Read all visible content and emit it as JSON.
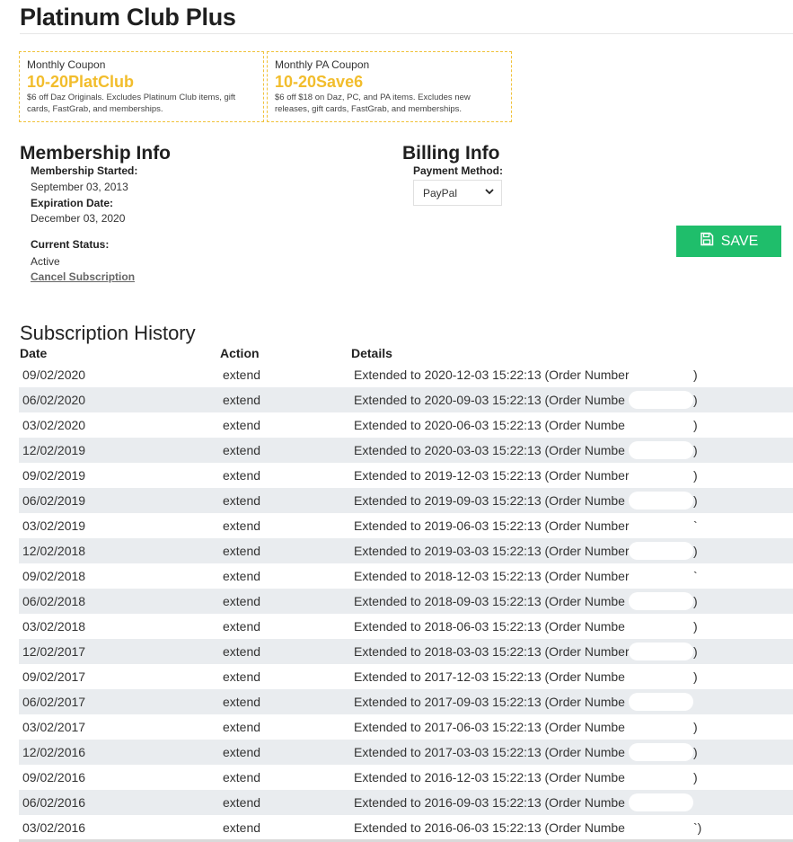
{
  "page": {
    "title": "Platinum Club Plus"
  },
  "coupons": [
    {
      "label": "Monthly Coupon",
      "code": "10-20PlatClub",
      "description": "$6 off Daz Originals. Excludes Platinum Club items, gift cards, FastGrab, and memberships."
    },
    {
      "label": "Monthly PA Coupon",
      "code": "10-20Save6",
      "description": "$6 off $18 on Daz, PC, and PA items. Excludes new releases, gift cards, FastGrab, and memberships."
    }
  ],
  "membership": {
    "heading": "Membership Info",
    "started_label": "Membership Started:",
    "started_value": "September 03, 2013",
    "expiration_label": "Expiration Date:",
    "expiration_value": "December 03, 2020",
    "status_label": "Current Status:",
    "status_value": "Active",
    "cancel_label": "Cancel Subscription"
  },
  "billing": {
    "heading": "Billing Info",
    "payment_label": "Payment Method:",
    "payment_value": "PayPal",
    "save_label": "SAVE"
  },
  "colors": {
    "save_button": "#1fbe6b",
    "coupon_code": "#f2bd2c",
    "row_alt": "#e9ecef"
  },
  "history": {
    "heading": "Subscription History",
    "columns": [
      "Date",
      "Action",
      "Details"
    ],
    "rows": [
      {
        "date": "09/02/2020",
        "action": "extend",
        "details": "Extended to 2020-12-03 15:22:13 (Order Number",
        "close": ")"
      },
      {
        "date": "06/02/2020",
        "action": "extend",
        "details": "Extended to 2020-09-03 15:22:13 (Order Numbe",
        "close": ")"
      },
      {
        "date": "03/02/2020",
        "action": "extend",
        "details": "Extended to 2020-06-03 15:22:13 (Order Numbe",
        "close": ")"
      },
      {
        "date": "12/02/2019",
        "action": "extend",
        "details": "Extended to 2020-03-03 15:22:13 (Order Numbe",
        "close": ")"
      },
      {
        "date": "09/02/2019",
        "action": "extend",
        "details": "Extended to 2019-12-03 15:22:13 (Order Number",
        "close": ")"
      },
      {
        "date": "06/02/2019",
        "action": "extend",
        "details": "Extended to 2019-09-03 15:22:13 (Order Numbe",
        "close": ")"
      },
      {
        "date": "03/02/2019",
        "action": "extend",
        "details": "Extended to 2019-06-03 15:22:13 (Order Number",
        "close": "`"
      },
      {
        "date": "12/02/2018",
        "action": "extend",
        "details": "Extended to 2019-03-03 15:22:13 (Order Number",
        "close": ")"
      },
      {
        "date": "09/02/2018",
        "action": "extend",
        "details": "Extended to 2018-12-03 15:22:13 (Order Number",
        "close": "`"
      },
      {
        "date": "06/02/2018",
        "action": "extend",
        "details": "Extended to 2018-09-03 15:22:13 (Order Numbe",
        "close": ")"
      },
      {
        "date": "03/02/2018",
        "action": "extend",
        "details": "Extended to 2018-06-03 15:22:13 (Order Numbe",
        "close": ")"
      },
      {
        "date": "12/02/2017",
        "action": "extend",
        "details": "Extended to 2018-03-03 15:22:13 (Order Number",
        "close": ")"
      },
      {
        "date": "09/02/2017",
        "action": "extend",
        "details": "Extended to 2017-12-03 15:22:13 (Order Numbe",
        "close": ")"
      },
      {
        "date": "06/02/2017",
        "action": "extend",
        "details": "Extended to 2017-09-03 15:22:13 (Order Numbe",
        "close": ""
      },
      {
        "date": "03/02/2017",
        "action": "extend",
        "details": "Extended to 2017-06-03 15:22:13 (Order Numbe",
        "close": ")"
      },
      {
        "date": "12/02/2016",
        "action": "extend",
        "details": "Extended to 2017-03-03 15:22:13 (Order Numbe",
        "close": ")"
      },
      {
        "date": "09/02/2016",
        "action": "extend",
        "details": "Extended to 2016-12-03 15:22:13 (Order Numbe",
        "close": ")"
      },
      {
        "date": "06/02/2016",
        "action": "extend",
        "details": "Extended to 2016-09-03 15:22:13 (Order Numbe",
        "close": ""
      },
      {
        "date": "03/02/2016",
        "action": "extend",
        "details": "Extended to 2016-06-03 15:22:13 (Order Numbe",
        "close": "`)"
      }
    ]
  }
}
